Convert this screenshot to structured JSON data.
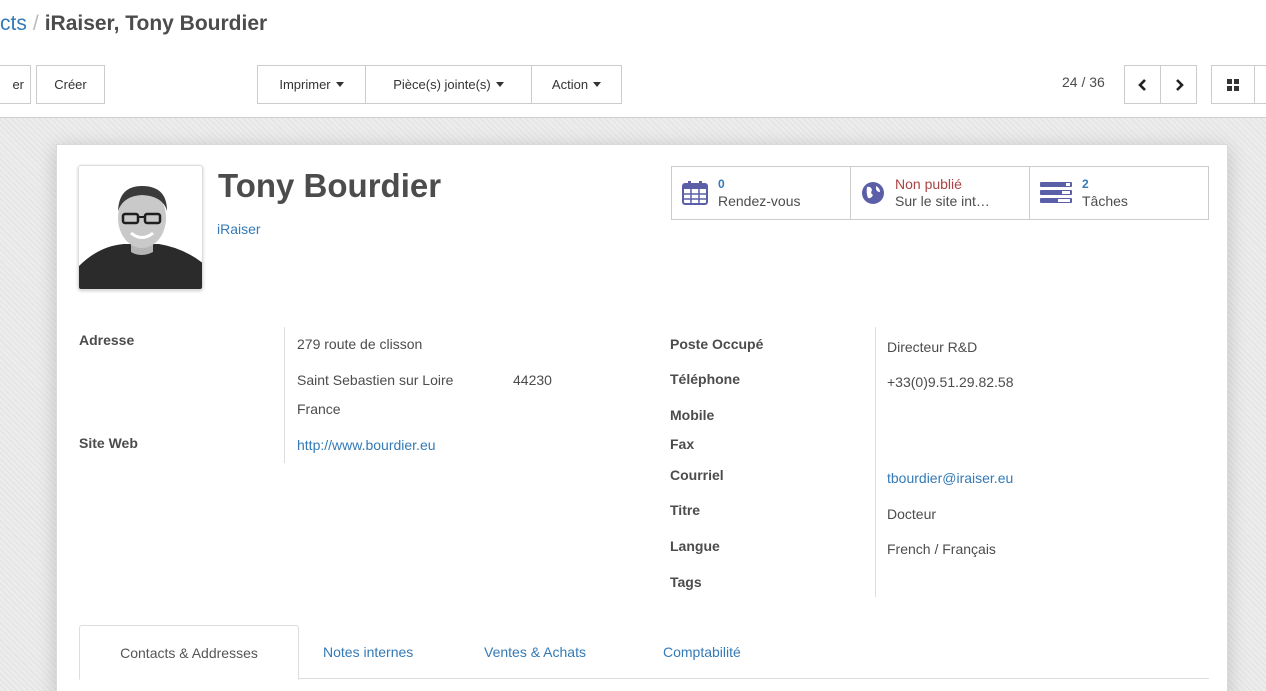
{
  "breadcrumb": {
    "parent_label": "cts",
    "separator": "/",
    "current_label": "iRaiser, Tony Bourdier"
  },
  "toolbar": {
    "edit_label": "er",
    "create_label": "Créer",
    "print_label": "Imprimer",
    "attachments_label": "Pièce(s) jointe(s)",
    "action_label": "Action"
  },
  "pager": {
    "value": "24 / 36"
  },
  "partner": {
    "name": "Tony Bourdier",
    "company": "iRaiser"
  },
  "smart_buttons": {
    "meetings": {
      "count": "0",
      "label": "Rendez-vous",
      "icon": "calendar-icon"
    },
    "website": {
      "status": "Non publié",
      "label": "Sur le site int…",
      "icon": "globe-icon"
    },
    "tasks": {
      "count": "2",
      "label": "Tâches",
      "icon": "tasks-icon"
    }
  },
  "fields_left": {
    "address_label": "Adresse",
    "street": "279 route de clisson",
    "city": "Saint Sebastien sur Loire",
    "zip": "44230",
    "country": "France",
    "website_label": "Site Web",
    "website_value": "http://www.bourdier.eu"
  },
  "fields_right": {
    "function_label": "Poste Occupé",
    "function_value": "Directeur R&D",
    "phone_label": "Téléphone",
    "phone_value": "+33(0)9.51.29.82.58",
    "mobile_label": "Mobile",
    "fax_label": "Fax",
    "email_label": "Courriel",
    "email_value": "tbourdier@iraiser.eu",
    "title_label": "Titre",
    "title_value": "Docteur",
    "lang_label": "Langue",
    "lang_value": "French / Français",
    "tags_label": "Tags"
  },
  "tabs": [
    {
      "label": "Contacts & Addresses",
      "active": true
    },
    {
      "label": "Notes internes",
      "active": false
    },
    {
      "label": "Ventes & Achats",
      "active": false
    },
    {
      "label": "Comptabilité",
      "active": false
    }
  ],
  "colors": {
    "link": "#337ab7",
    "unpublished": "#a94442",
    "smart_icon": "#5b5fa8"
  }
}
